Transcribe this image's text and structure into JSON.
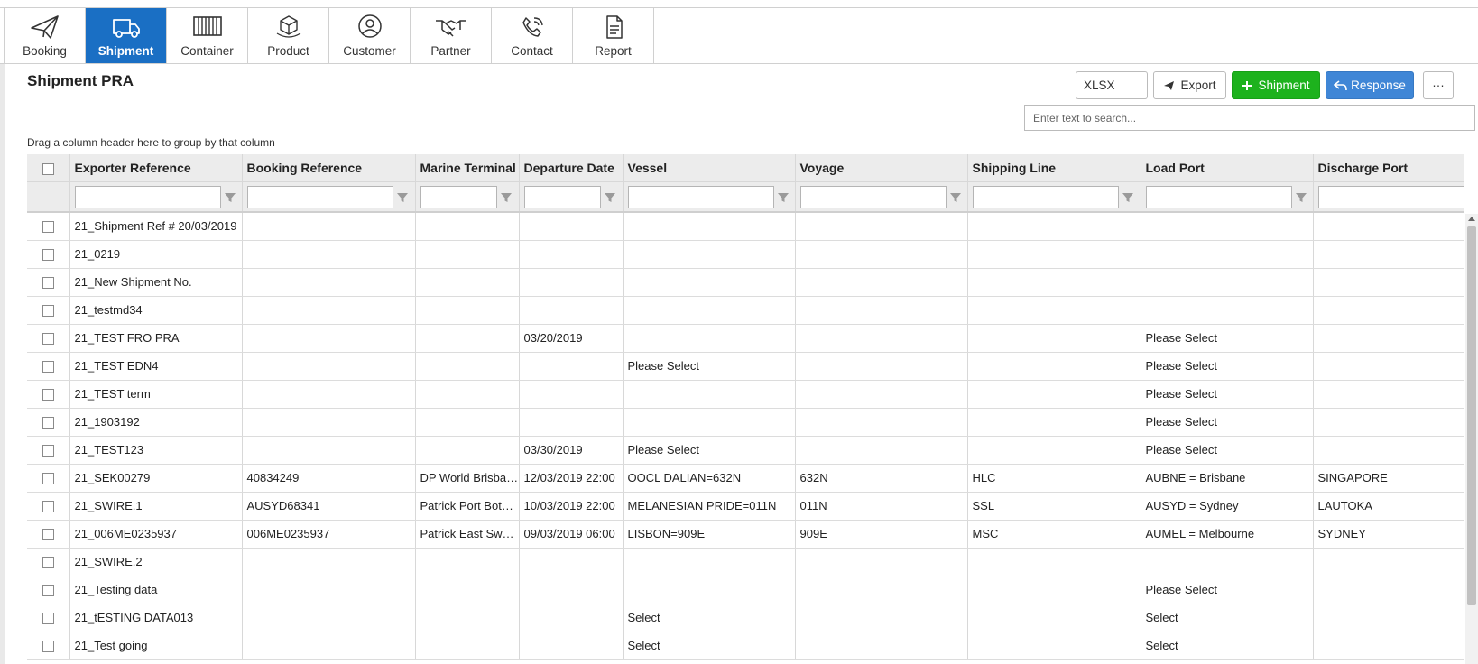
{
  "nav": {
    "items": [
      {
        "label": "Booking",
        "icon": "paper-plane-icon",
        "active": false
      },
      {
        "label": "Shipment",
        "icon": "truck-icon",
        "active": true
      },
      {
        "label": "Container",
        "icon": "container-icon",
        "active": false
      },
      {
        "label": "Product",
        "icon": "box-icon",
        "active": false
      },
      {
        "label": "Customer",
        "icon": "user-icon",
        "active": false
      },
      {
        "label": "Partner",
        "icon": "handshake-icon",
        "active": false
      },
      {
        "label": "Contact",
        "icon": "phone-icon",
        "active": false
      },
      {
        "label": "Report",
        "icon": "document-icon",
        "active": false
      }
    ]
  },
  "page": {
    "title": "Shipment PRA",
    "group_hint": "Drag a column header here to group by that column"
  },
  "toolbar": {
    "format_value": "XLSX",
    "export_label": "Export",
    "add_shipment_label": "Shipment",
    "response_label": "Response",
    "more_label": "···"
  },
  "search": {
    "placeholder": "Enter text to search..."
  },
  "colors": {
    "primary": "#1a6fc4",
    "green": "#1db21d",
    "blue": "#3f86d6"
  },
  "grid": {
    "columns": [
      "Exporter Reference",
      "Booking Reference",
      "Marine Terminal",
      "Departure Date",
      "Vessel",
      "Voyage",
      "Shipping Line",
      "Load Port",
      "Discharge Port"
    ],
    "rows": [
      [
        "21_Shipment Ref # 20/03/2019",
        "",
        "",
        "",
        "",
        "",
        "",
        "",
        ""
      ],
      [
        "21_0219",
        "",
        "",
        "",
        "",
        "",
        "",
        "",
        ""
      ],
      [
        "21_New Shipment No.",
        "",
        "",
        "",
        "",
        "",
        "",
        "",
        ""
      ],
      [
        "21_testmd34",
        "",
        "",
        "",
        "",
        "",
        "",
        "",
        ""
      ],
      [
        "21_TEST FRO PRA",
        "",
        "",
        "03/20/2019",
        "",
        "",
        "",
        "Please Select",
        ""
      ],
      [
        "21_TEST EDN4",
        "",
        "",
        "",
        "Please Select",
        "",
        "",
        "Please Select",
        ""
      ],
      [
        "21_TEST term",
        "",
        "",
        "",
        "",
        "",
        "",
        "Please Select",
        ""
      ],
      [
        "21_1903192",
        "",
        "",
        "",
        "",
        "",
        "",
        "Please Select",
        ""
      ],
      [
        "21_TEST123",
        "",
        "",
        "03/30/2019",
        "Please Select",
        "",
        "",
        "Please Select",
        ""
      ],
      [
        "21_SEK00279",
        "40834249",
        "DP World Brisbane",
        "12/03/2019 22:00",
        "OOCL DALIAN=632N",
        "632N",
        "HLC",
        "AUBNE = Brisbane",
        "SINGAPORE"
      ],
      [
        "21_SWIRE.1",
        "AUSYD68341",
        "Patrick Port Botany",
        "10/03/2019 22:00",
        "MELANESIAN PRIDE=011N",
        "011N",
        "SSL",
        "AUSYD = Sydney",
        "LAUTOKA"
      ],
      [
        "21_006ME0235937",
        "006ME0235937",
        "Patrick East Swanson",
        "09/03/2019 06:00",
        "LISBON=909E",
        "909E",
        "MSC",
        "AUMEL = Melbourne",
        "SYDNEY"
      ],
      [
        "21_SWIRE.2",
        "",
        "",
        "",
        "",
        "",
        "",
        "",
        ""
      ],
      [
        "21_Testing data",
        "",
        "",
        "",
        "",
        "",
        "",
        "Please Select",
        ""
      ],
      [
        "21_tESTING DATA013",
        "",
        "",
        "",
        "Select",
        "",
        "",
        "Select",
        ""
      ],
      [
        "21_Test going",
        "",
        "",
        "",
        "Select",
        "",
        "",
        "Select",
        ""
      ]
    ]
  }
}
